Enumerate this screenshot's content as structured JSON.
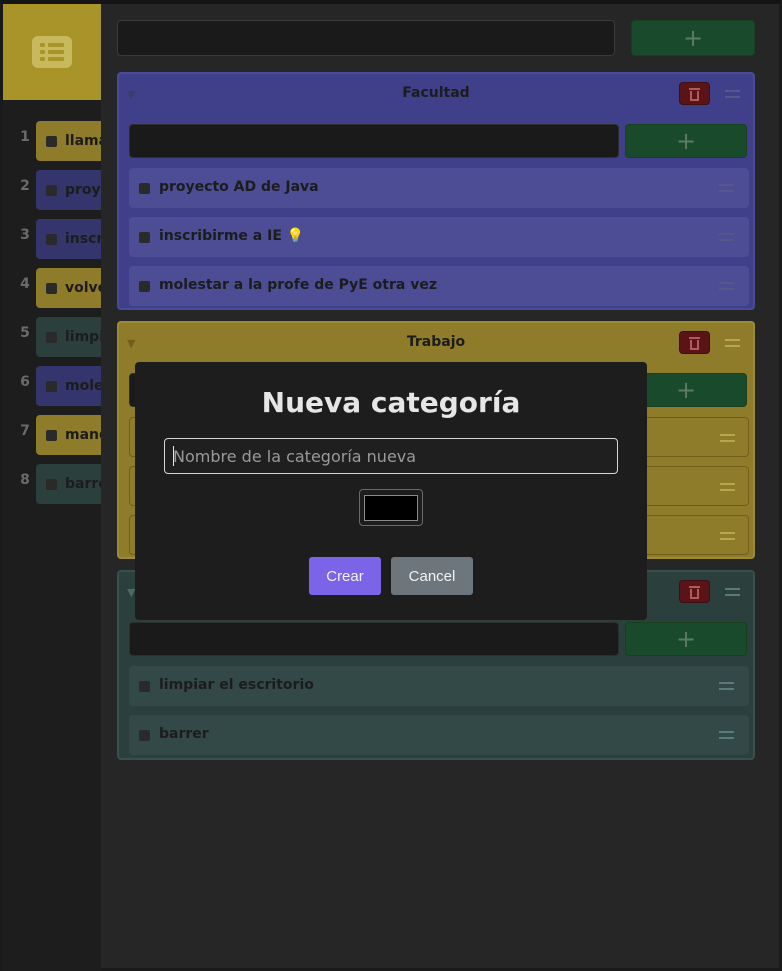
{
  "sidebar": {
    "logo_icon": "list-icon",
    "items": [
      {
        "num": "1",
        "label": "llamar",
        "color": "#8e7c2a"
      },
      {
        "num": "2",
        "label": "proyecto",
        "color": "#35356e"
      },
      {
        "num": "3",
        "label": "inscribirme",
        "color": "#35356e"
      },
      {
        "num": "4",
        "label": "volver",
        "color": "#8e7c2a"
      },
      {
        "num": "5",
        "label": "limpiar",
        "color": "#2b3f3d"
      },
      {
        "num": "6",
        "label": "molestar",
        "color": "#35356e"
      },
      {
        "num": "7",
        "label": "manda",
        "color": "#8e7c2a"
      },
      {
        "num": "8",
        "label": "barrer",
        "color": "#2b3f3d"
      }
    ]
  },
  "header": {
    "input_value": "",
    "add_label": "+"
  },
  "categories": [
    {
      "title": "Facultad",
      "color": "#3f3f8a",
      "add_label": "+",
      "items": [
        {
          "label": "proyecto AD de Java"
        },
        {
          "label": "inscribirme a IE 💡"
        },
        {
          "label": "molestar a la profe de PyE otra vez"
        }
      ]
    },
    {
      "title": "Trabajo",
      "color": "#8e7c2a",
      "add_label": "+",
      "items": []
    },
    {
      "title": "",
      "color": "#2b3f3d",
      "add_label": "+",
      "items": [
        {
          "label": "limpiar el escritorio"
        },
        {
          "label": "barrer"
        }
      ]
    }
  ],
  "modal": {
    "title": "Nueva categoría",
    "input_placeholder": "Nombre de la categoría nueva",
    "color_value": "#000000",
    "create_label": "Crear",
    "cancel_label": "Cancel"
  }
}
